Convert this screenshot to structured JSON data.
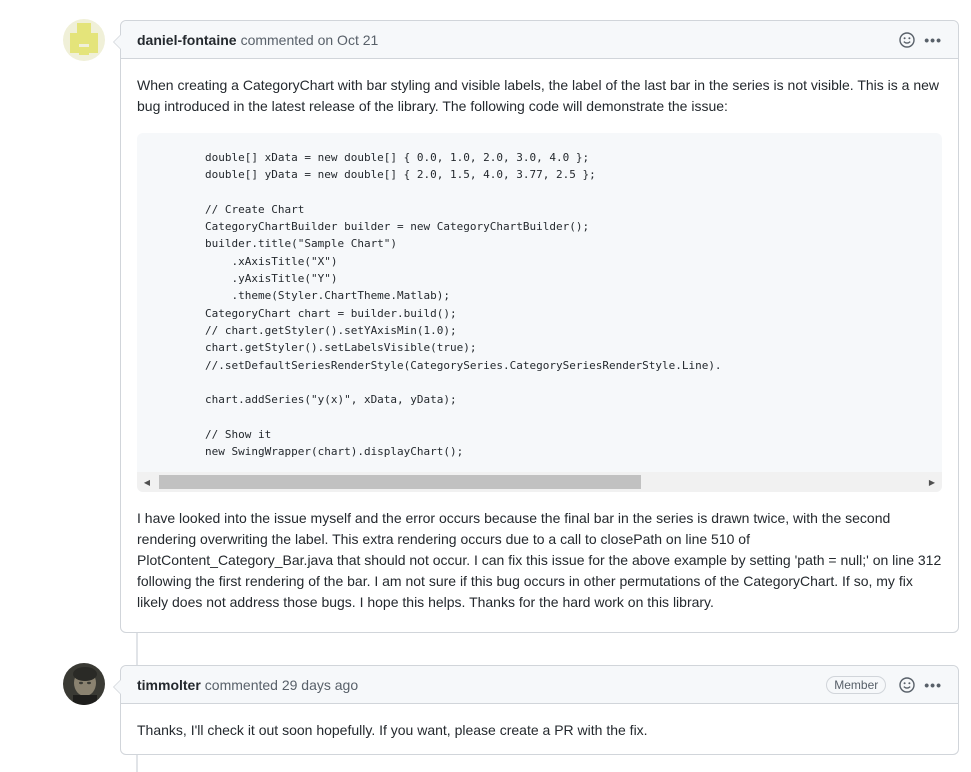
{
  "comments": [
    {
      "author": "daniel-fontaine",
      "meta": "commented on Oct 21",
      "paragraph1": "When creating a CategoryChart with bar styling and visible labels, the label of the last bar in the series is not visible. This is a new bug introduced in the latest release of the library. The following code will demonstrate the issue:",
      "code": "double[] xData = new double[] { 0.0, 1.0, 2.0, 3.0, 4.0 };\ndouble[] yData = new double[] { 2.0, 1.5, 4.0, 3.77, 2.5 };\n\n// Create Chart\nCategoryChartBuilder builder = new CategoryChartBuilder();\nbuilder.title(\"Sample Chart\")\n    .xAxisTitle(\"X\")\n    .yAxisTitle(\"Y\")\n    .theme(Styler.ChartTheme.Matlab);\nCategoryChart chart = builder.build();\n// chart.getStyler().setYAxisMin(1.0);\nchart.getStyler().setLabelsVisible(true);\n//.setDefaultSeriesRenderStyle(CategorySeries.CategorySeriesRenderStyle.Line).\n\nchart.addSeries(\"y(x)\", xData, yData);\n\n// Show it\nnew SwingWrapper(chart).displayChart();",
      "paragraph2": "I have looked into the issue myself and the error occurs because the final bar in the series is drawn twice, with the second rendering overwriting the label. This extra rendering occurs due to a call to closePath on line 510 of PlotContent_Category_Bar.java that should not occur. I can fix this issue for the above example by setting 'path = null;' on line 312 following the first rendering of the bar. I am not sure if this bug occurs in other permutations of the CategoryChart. If so, my fix likely does not address those bugs. I hope this helps. Thanks for the hard work on this library."
    },
    {
      "author": "timmolter",
      "meta": "commented 29 days ago",
      "badge": "Member",
      "paragraph1": "Thanks, I'll check it out soon hopefully. If you want, please create a PR with the fix."
    }
  ],
  "icons": {
    "emoji": "smiley-icon",
    "more": "kebab-icon"
  },
  "more_label": "•••"
}
